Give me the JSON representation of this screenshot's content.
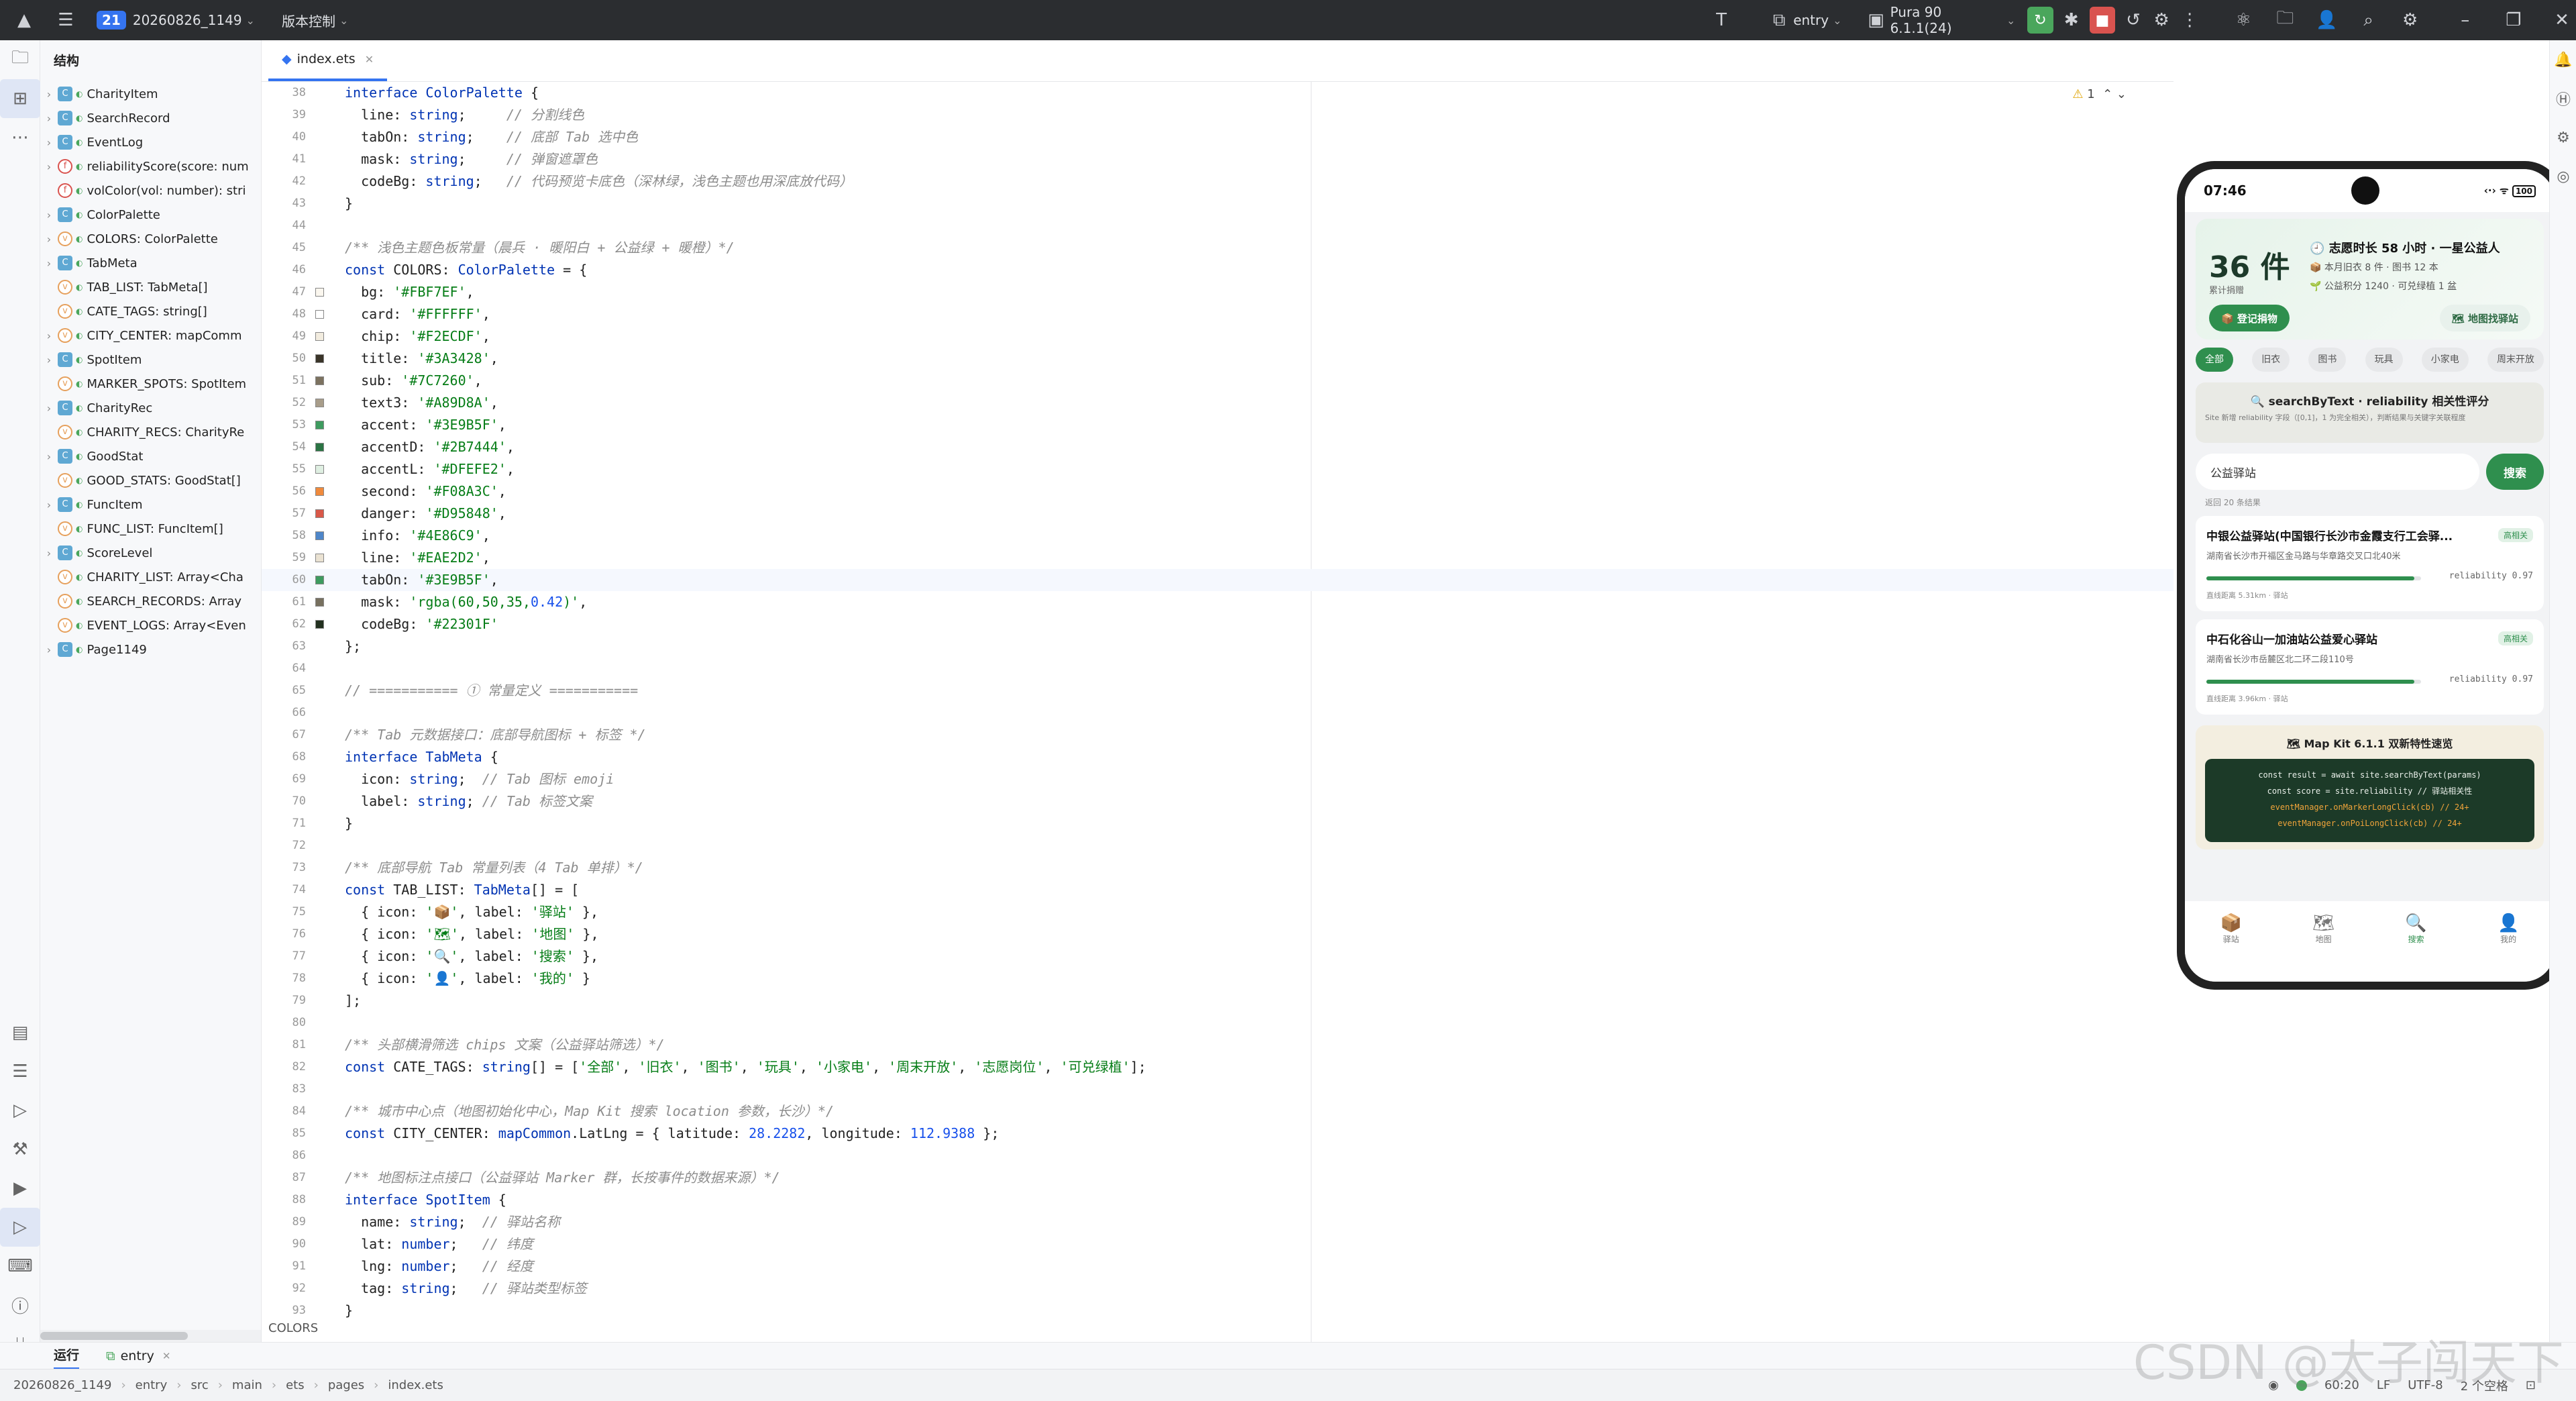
{
  "toolbar": {
    "project_badge": "21",
    "project_name": "20260826_1149",
    "vcs": "版本控制",
    "run_config": "entry",
    "device": "Pura 90 6.1.1(24)"
  },
  "structure": {
    "title": "结构",
    "items": [
      {
        "kind": "c",
        "label": "CharityItem",
        "expand": true
      },
      {
        "kind": "c",
        "label": "SearchRecord",
        "expand": true
      },
      {
        "kind": "c",
        "label": "EventLog",
        "expand": true
      },
      {
        "kind": "f",
        "label": "reliabilityScore(score: num",
        "expand": true
      },
      {
        "kind": "f",
        "label": "volColor(vol: number): stri",
        "expand": false
      },
      {
        "kind": "c",
        "label": "ColorPalette",
        "expand": true
      },
      {
        "kind": "v",
        "label": "COLORS: ColorPalette",
        "expand": true
      },
      {
        "kind": "c",
        "label": "TabMeta",
        "expand": true
      },
      {
        "kind": "v",
        "label": "TAB_LIST: TabMeta[]",
        "expand": false
      },
      {
        "kind": "v",
        "label": "CATE_TAGS: string[]",
        "expand": false
      },
      {
        "kind": "v",
        "label": "CITY_CENTER: mapComm",
        "expand": true
      },
      {
        "kind": "c",
        "label": "SpotItem",
        "expand": true
      },
      {
        "kind": "v",
        "label": "MARKER_SPOTS: SpotItem",
        "expand": false
      },
      {
        "kind": "c",
        "label": "CharityRec",
        "expand": true
      },
      {
        "kind": "v",
        "label": "CHARITY_RECS: CharityRe",
        "expand": false
      },
      {
        "kind": "c",
        "label": "GoodStat",
        "expand": true
      },
      {
        "kind": "v",
        "label": "GOOD_STATS: GoodStat[]",
        "expand": false
      },
      {
        "kind": "c",
        "label": "FuncItem",
        "expand": true
      },
      {
        "kind": "v",
        "label": "FUNC_LIST: FuncItem[]",
        "expand": false
      },
      {
        "kind": "c",
        "label": "ScoreLevel",
        "expand": true
      },
      {
        "kind": "v",
        "label": "CHARITY_LIST: Array<Cha",
        "expand": false
      },
      {
        "kind": "v",
        "label": "SEARCH_RECORDS: Array",
        "expand": false
      },
      {
        "kind": "v",
        "label": "EVENT_LOGS: Array<Even",
        "expand": false
      },
      {
        "kind": "c",
        "label": "Page1149",
        "expand": true
      }
    ]
  },
  "editor": {
    "tab": "index.ets",
    "lint": "1",
    "breadcrumb": "COLORS",
    "lines": [
      {
        "n": "38",
        "t": "interface ColorPalette {",
        "sw": null
      },
      {
        "n": "39",
        "t": "  line: string;     // 分割线色",
        "sw": null
      },
      {
        "n": "40",
        "t": "  tabOn: string;    // 底部 Tab 选中色",
        "sw": null
      },
      {
        "n": "41",
        "t": "  mask: string;     // 弹窗遮罩色",
        "sw": null
      },
      {
        "n": "42",
        "t": "  codeBg: string;   // 代码预览卡底色（深林绿，浅色主题也用深底放代码）",
        "sw": null
      },
      {
        "n": "43",
        "t": "}",
        "sw": null
      },
      {
        "n": "44",
        "t": "",
        "sw": null
      },
      {
        "n": "45",
        "t": "/** 浅色主题色板常量（晨兵 · 暖阳白 + 公益绿 + 暖橙）*/",
        "sw": null
      },
      {
        "n": "46",
        "t": "const COLORS: ColorPalette = {",
        "sw": null
      },
      {
        "n": "47",
        "t": "  bg: '#FBF7EF',",
        "sw": "#FBF7EF"
      },
      {
        "n": "48",
        "t": "  card: '#FFFFFF',",
        "sw": "#FFFFFF"
      },
      {
        "n": "49",
        "t": "  chip: '#F2ECDF',",
        "sw": "#F2ECDF"
      },
      {
        "n": "50",
        "t": "  title: '#3A3428',",
        "sw": "#3A3428"
      },
      {
        "n": "51",
        "t": "  sub: '#7C7260',",
        "sw": "#7C7260"
      },
      {
        "n": "52",
        "t": "  text3: '#A89D8A',",
        "sw": "#A89D8A"
      },
      {
        "n": "53",
        "t": "  accent: '#3E9B5F',",
        "sw": "#3E9B5F"
      },
      {
        "n": "54",
        "t": "  accentD: '#2B7444',",
        "sw": "#2B7444"
      },
      {
        "n": "55",
        "t": "  accentL: '#DFEFE2',",
        "sw": "#DFEFE2"
      },
      {
        "n": "56",
        "t": "  second: '#F08A3C',",
        "sw": "#F08A3C"
      },
      {
        "n": "57",
        "t": "  danger: '#D95848',",
        "sw": "#D95848"
      },
      {
        "n": "58",
        "t": "  info: '#4E86C9',",
        "sw": "#4E86C9"
      },
      {
        "n": "59",
        "t": "  line: '#EAE2D2',",
        "sw": "#EAE2D2"
      },
      {
        "n": "60",
        "t": "  tabOn: '#3E9B5F',",
        "sw": "#3E9B5F"
      },
      {
        "n": "61",
        "t": "  mask: 'rgba(60,50,35,0.42)',",
        "sw": "#77705F"
      },
      {
        "n": "62",
        "t": "  codeBg: '#22301F'",
        "sw": "#22301F"
      },
      {
        "n": "63",
        "t": "};",
        "sw": null
      },
      {
        "n": "64",
        "t": "",
        "sw": null
      },
      {
        "n": "65",
        "t": "// =========== ① 常量定义 ===========",
        "sw": null
      },
      {
        "n": "66",
        "t": "",
        "sw": null
      },
      {
        "n": "67",
        "t": "/** Tab 元数据接口：底部导航图标 + 标签 */",
        "sw": null
      },
      {
        "n": "68",
        "t": "interface TabMeta {",
        "sw": null
      },
      {
        "n": "69",
        "t": "  icon: string;  // Tab 图标 emoji",
        "sw": null
      },
      {
        "n": "70",
        "t": "  label: string; // Tab 标签文案",
        "sw": null
      },
      {
        "n": "71",
        "t": "}",
        "sw": null
      },
      {
        "n": "72",
        "t": "",
        "sw": null
      },
      {
        "n": "73",
        "t": "/** 底部导航 Tab 常量列表（4 Tab 单排）*/",
        "sw": null
      },
      {
        "n": "74",
        "t": "const TAB_LIST: TabMeta[] = [",
        "sw": null
      },
      {
        "n": "75",
        "t": "  { icon: '📦', label: '驿站' },",
        "sw": null
      },
      {
        "n": "76",
        "t": "  { icon: '🗺', label: '地图' },",
        "sw": null
      },
      {
        "n": "77",
        "t": "  { icon: '🔍', label: '搜索' },",
        "sw": null
      },
      {
        "n": "78",
        "t": "  { icon: '👤', label: '我的' }",
        "sw": null
      },
      {
        "n": "79",
        "t": "];",
        "sw": null
      },
      {
        "n": "80",
        "t": "",
        "sw": null
      },
      {
        "n": "81",
        "t": "/** 头部横滑筛选 chips 文案（公益驿站筛选）*/",
        "sw": null
      },
      {
        "n": "82",
        "t": "const CATE_TAGS: string[] = ['全部', '旧衣', '图书', '玩具', '小家电', '周末开放', '志愿岗位', '可兑绿植'];",
        "sw": null
      },
      {
        "n": "83",
        "t": "",
        "sw": null
      },
      {
        "n": "84",
        "t": "/** 城市中心点（地图初始化中心，Map Kit 搜索 location 参数，长沙）*/",
        "sw": null
      },
      {
        "n": "85",
        "t": "const CITY_CENTER: mapCommon.LatLng = { latitude: 28.2282, longitude: 112.9388 };",
        "sw": null
      },
      {
        "n": "86",
        "t": "",
        "sw": null
      },
      {
        "n": "87",
        "t": "/** 地图标注点接口（公益驿站 Marker 群，长按事件的数据来源）*/",
        "sw": null
      },
      {
        "n": "88",
        "t": "interface SpotItem {",
        "sw": null
      },
      {
        "n": "89",
        "t": "  name: string;  // 驿站名称",
        "sw": null
      },
      {
        "n": "90",
        "t": "  lat: number;   // 纬度",
        "sw": null
      },
      {
        "n": "91",
        "t": "  lng: number;   // 经度",
        "sw": null
      },
      {
        "n": "92",
        "t": "  tag: string;   // 驿站类型标签",
        "sw": null
      },
      {
        "n": "93",
        "t": "}",
        "sw": null
      }
    ]
  },
  "phone": {
    "time": "07:46",
    "battery": "100",
    "hero": {
      "count": "36 件",
      "count_label": "累计捐赠",
      "title": "志愿时长 58 小时 · 一星公益人",
      "line2": "本月旧衣 8 件 · 图书 12 本",
      "line3": "公益积分 1240 · 可兑绿植 1 盆",
      "btn1": "📦 登记捐物",
      "btn2": "🗺 地图找驿站"
    },
    "chips": [
      "全部",
      "旧衣",
      "图书",
      "玩具",
      "小家电",
      "周末开放"
    ],
    "info_title": "🔍 searchByText · reliability 相关性评分",
    "info_desc": "Site 新增 reliability 字段（[0,1]，1 为完全相关），判断结果与关键字关联程度",
    "search_value": "公益驿站",
    "search_btn": "搜索",
    "result_count": "返回 20 条结果",
    "results": [
      {
        "name": "中银公益驿站(中国银行长沙市金霞支行工会驿...",
        "tag": "高相关",
        "addr": "湖南省长沙市开福区金马路与华章路交叉口北40米",
        "rel": "reliability 0.97",
        "score": 0.97,
        "dist": "直线距离 5.31km  · 驿站"
      },
      {
        "name": "中石化谷山一加油站公益爱心驿站",
        "tag": "高相关",
        "addr": "湖南省长沙市岳麓区北二环二段110号",
        "rel": "reliability 0.97",
        "score": 0.97,
        "dist": "直线距离 3.96km  · 驿站"
      }
    ],
    "map_title": "🗺 Map Kit 6.1.1 双新特性速览",
    "code1": "const result = await site.searchByText(params)",
    "code2": "const score = site.reliability  // 驿站相关性",
    "code3": "eventManager.onMarkerLongClick(cb)  // 24+",
    "code4": "eventManager.onPoiLongClick(cb)     // 24+",
    "nav": [
      {
        "icon": "📦",
        "label": "驿站",
        "on": false
      },
      {
        "icon": "🗺",
        "label": "地图",
        "on": false
      },
      {
        "icon": "🔍",
        "label": "搜索",
        "on": true
      },
      {
        "icon": "👤",
        "label": "我的",
        "on": false
      }
    ]
  },
  "bottom": {
    "run": "运行",
    "entry": "entry"
  },
  "status": {
    "path": [
      "20260826_1149",
      "entry",
      "src",
      "main",
      "ets",
      "pages",
      "index.ets"
    ],
    "pos": "60:20",
    "le": "LF",
    "enc": "UTF-8",
    "indent": "2 个空格"
  },
  "watermark": "CSDN @太子闯天下"
}
